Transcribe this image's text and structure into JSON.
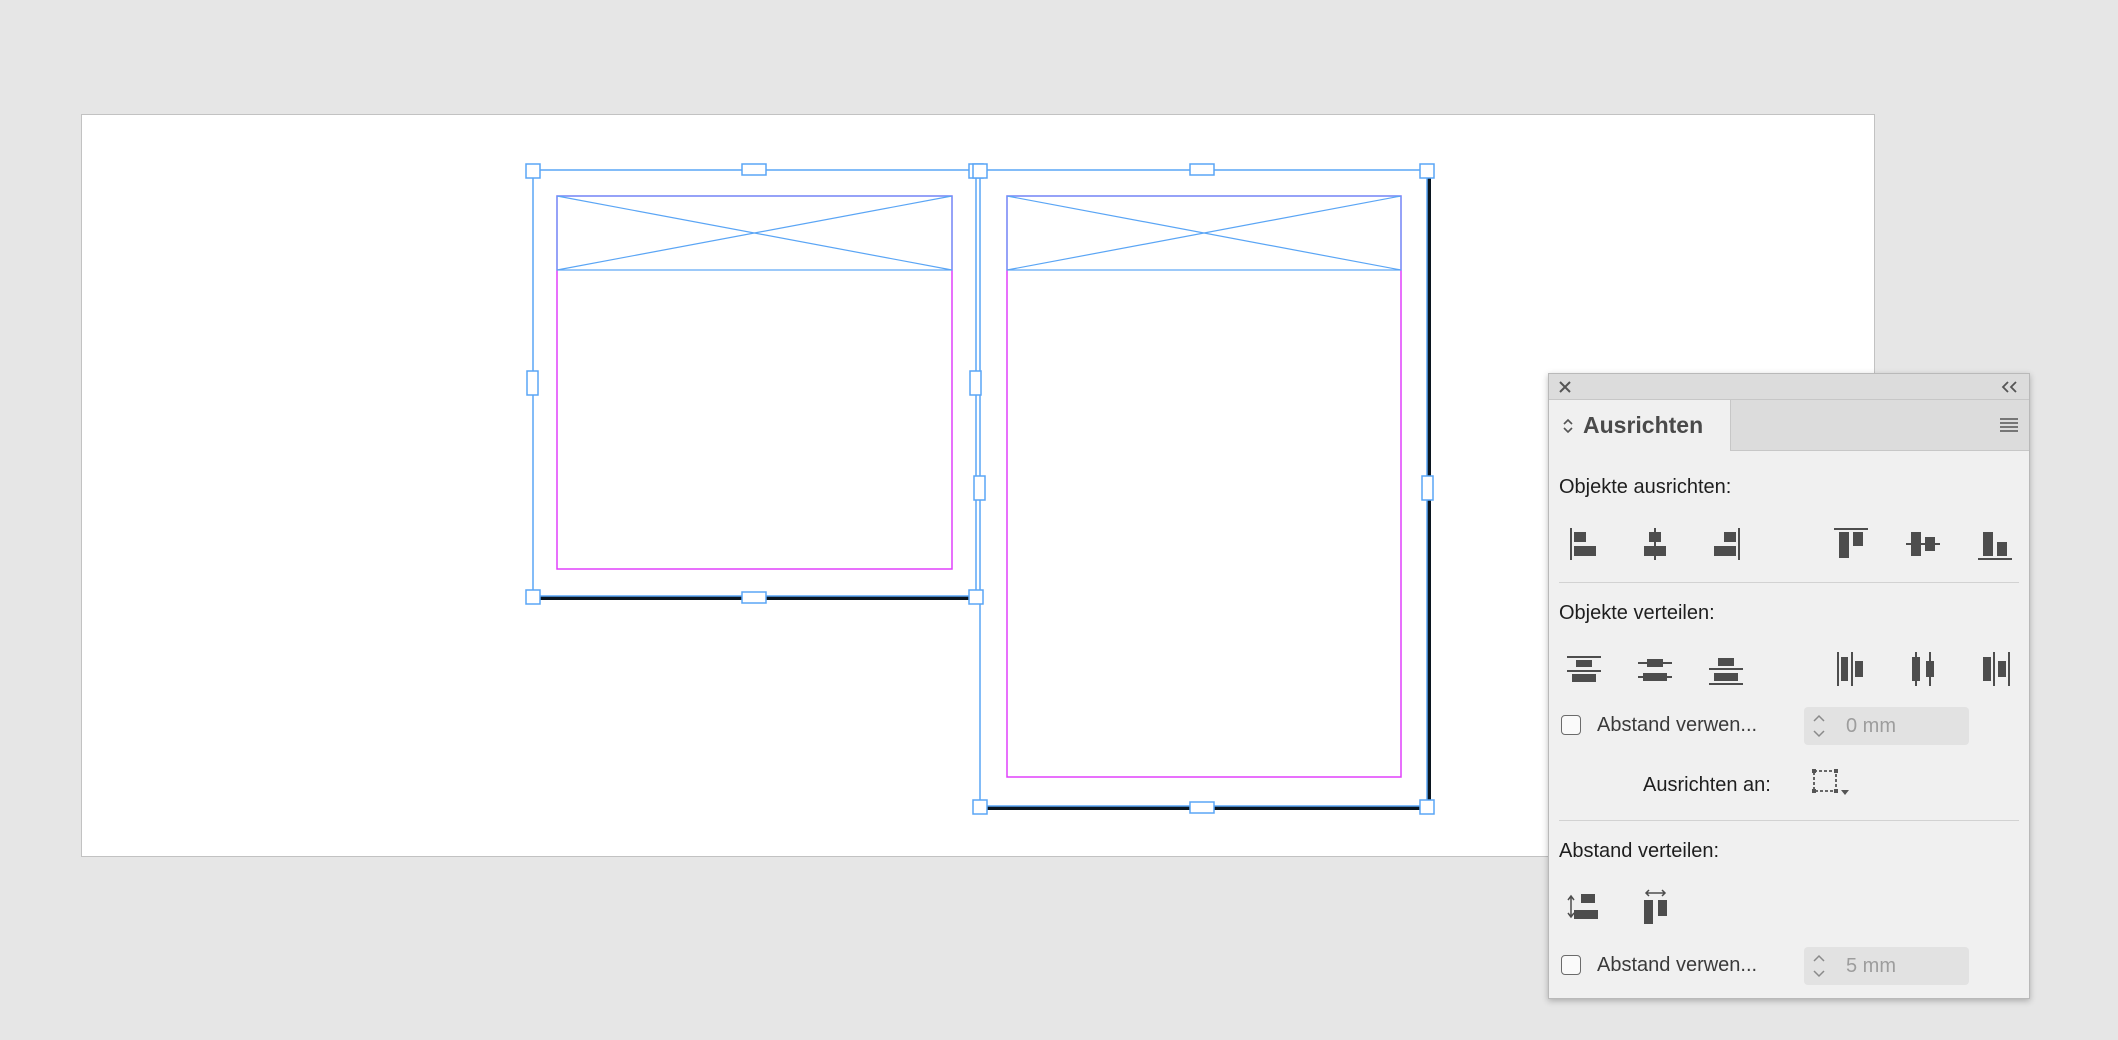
{
  "canvas": {
    "page_color": "#ffffff",
    "frame_color": "#5aa5f5",
    "margin_color": "#e040fb",
    "stroke_color": "#0b1620"
  },
  "panel": {
    "title": "Ausrichten",
    "close_icon": "close-icon",
    "collapse_icon": "collapse-double-chevron-icon",
    "menu_icon": "panel-menu-icon",
    "sections": {
      "align_objects": {
        "label": "Objekte ausrichten:",
        "buttons": [
          "align-left-edges-icon",
          "align-horizontal-centers-icon",
          "align-right-edges-icon",
          "align-top-edges-icon",
          "align-vertical-centers-icon",
          "align-bottom-edges-icon"
        ]
      },
      "distribute_objects": {
        "label": "Objekte verteilen:",
        "buttons": [
          "distribute-top-edges-icon",
          "distribute-vertical-centers-icon",
          "distribute-bottom-edges-icon",
          "distribute-left-edges-icon",
          "distribute-horizontal-centers-icon",
          "distribute-right-edges-icon"
        ],
        "use_spacing_label": "Abstand verwen...",
        "use_spacing_checked": false,
        "spacing_value": "0 mm"
      },
      "align_to": {
        "label": "Ausrichten an:",
        "icon": "align-to-selection-icon"
      },
      "distribute_spacing": {
        "label": "Abstand verteilen:",
        "buttons": [
          "distribute-vertical-space-icon",
          "distribute-horizontal-space-icon"
        ],
        "use_spacing_label": "Abstand verwen...",
        "use_spacing_checked": false,
        "spacing_value": "5 mm"
      }
    }
  }
}
